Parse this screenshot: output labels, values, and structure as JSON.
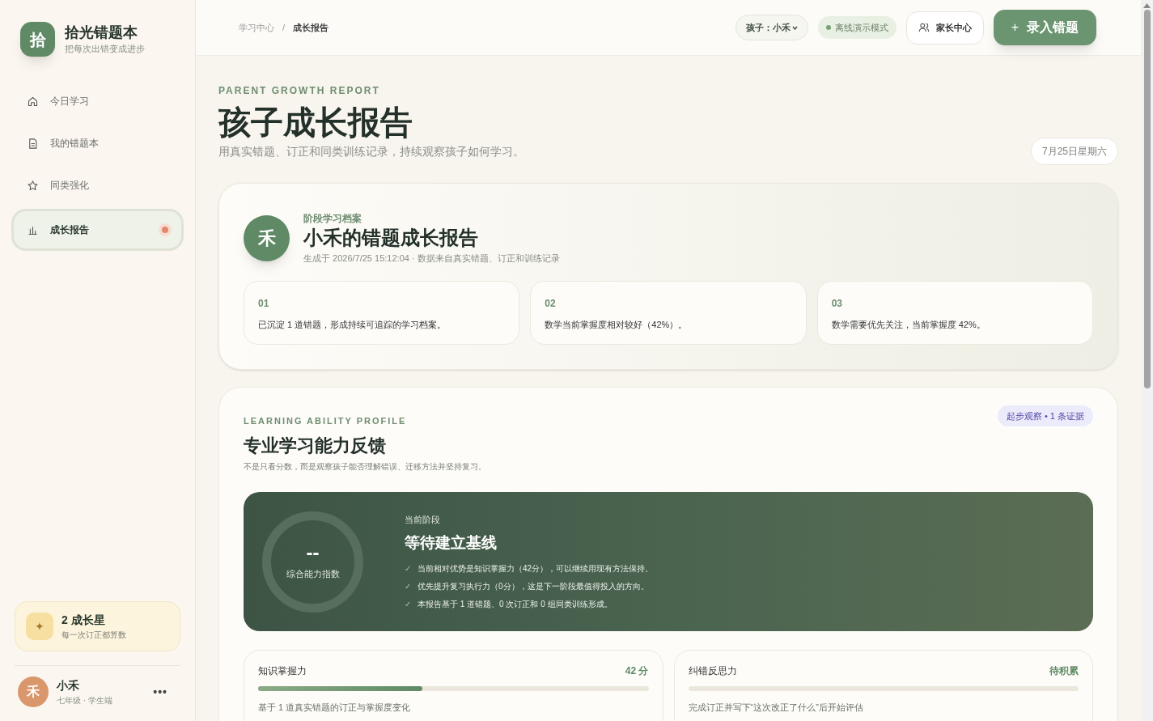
{
  "brand": {
    "logo": "拾",
    "name": "拾光错题本",
    "tagline": "把每次出错变成进步"
  },
  "nav": [
    {
      "label": "今日学习",
      "selected": false,
      "dot": false
    },
    {
      "label": "我的错题本",
      "selected": false,
      "dot": false
    },
    {
      "label": "同类强化",
      "selected": false,
      "dot": false
    },
    {
      "label": "成长报告",
      "selected": true,
      "dot": true
    }
  ],
  "stars_card": {
    "icon": "✦",
    "title": "2 成长星",
    "subtitle": "每一次订正都算数"
  },
  "user": {
    "avatar": "禾",
    "name": "小禾",
    "role": "七年级 · 学生端",
    "menu": "•••"
  },
  "breadcrumb": [
    "学习中心",
    "/",
    "成长报告"
  ],
  "topbar": {
    "child_select": "孩子：小禾",
    "mode": "离线演示模式",
    "parent_center": "家长中心",
    "add_button": "录入错题",
    "add_icon": "+"
  },
  "header": {
    "eyebrow": "PARENT GROWTH REPORT",
    "title": "孩子成长报告",
    "subtitle": "用真实错题、订正和同类训练记录，持续观察孩子如何学习。",
    "date": "7月25日星期六"
  },
  "report": {
    "avatar": "禾",
    "eyebrow": "阶段学习档案",
    "title": "小禾的错题成长报告",
    "meta": "生成于 2026/7/25 15:12:04 · 数据来自真实错题、订正和训练记录",
    "findings": [
      {
        "number": "01",
        "text": "已沉淀 1 道错题，形成持续可追踪的学习档案。"
      },
      {
        "number": "02",
        "text": "数学当前掌握度相对较好（42%）。"
      },
      {
        "number": "03",
        "text": "数学需要优先关注，当前掌握度 42%。"
      }
    ]
  },
  "ability": {
    "eyebrow": "LEARNING ABILITY PROFILE",
    "title": "专业学习能力反馈",
    "subtitle": "不是只看分数，而是观察孩子能否理解错误、迁移方法并坚持复习。",
    "badge": "起步观察 • 1 条证据",
    "score": "--",
    "score_label": "综合能力指数",
    "stage_label": "当前阶段",
    "stage": "等待建立基线",
    "points": [
      {
        "mark": "✓",
        "text": "当前相对优势是知识掌握力（42分），可以继续用现有方法保持。"
      },
      {
        "mark": "✓",
        "text": "优先提升复习执行力（0分），这是下一阶段最值得投入的方向。"
      },
      {
        "mark": "✓",
        "text": "本报告基于 1 道错题、0 次订正和 0 组同类训练形成。"
      }
    ],
    "metrics": [
      {
        "name": "知识掌握力",
        "score": "42 分",
        "level": 0.42,
        "note": "基于 1 道真实错题的订正与掌握度变化"
      },
      {
        "name": "纠错反思力",
        "score": "待积累",
        "level": 0,
        "note": "完成订正并写下“这次改正了什么”后开始评估"
      }
    ]
  }
}
